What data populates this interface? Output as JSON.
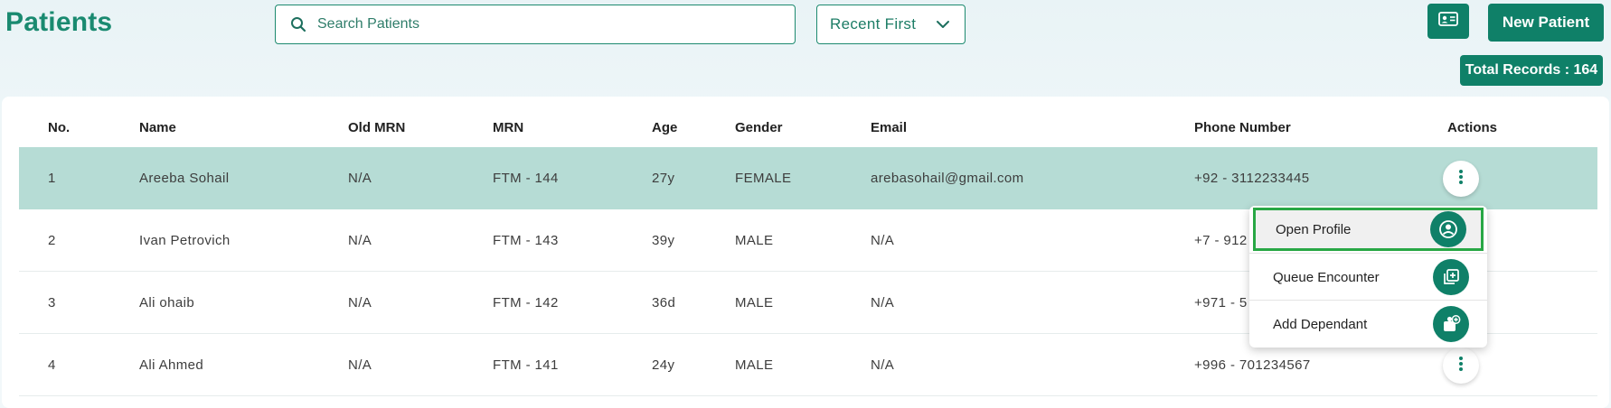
{
  "header": {
    "title": "Patients",
    "search": {
      "placeholder": "Search Patients",
      "value": ""
    },
    "sort": {
      "selected": "Recent First"
    },
    "new_patient_label": "New Patient",
    "total_records_label": "Total Records : 164"
  },
  "table": {
    "columns": [
      "No.",
      "Name",
      "Old MRN",
      "MRN",
      "Age",
      "Gender",
      "Email",
      "Phone Number",
      "Actions"
    ],
    "rows": [
      {
        "no": "1",
        "name": "Areeba Sohail",
        "old_mrn": "N/A",
        "mrn": "FTM - 144",
        "age": "27y",
        "gender": "FEMALE",
        "email": "arebasohail@gmail.com",
        "phone": "+92 - 3112233445"
      },
      {
        "no": "2",
        "name": "Ivan Petrovich",
        "old_mrn": "N/A",
        "mrn": "FTM - 143",
        "age": "39y",
        "gender": "MALE",
        "email": "N/A",
        "phone": "+7 - 912"
      },
      {
        "no": "3",
        "name": "Ali ohaib",
        "old_mrn": "N/A",
        "mrn": "FTM - 142",
        "age": "36d",
        "gender": "MALE",
        "email": "N/A",
        "phone": "+971 - 5"
      },
      {
        "no": "4",
        "name": "Ali Ahmed",
        "old_mrn": "N/A",
        "mrn": "FTM - 141",
        "age": "24y",
        "gender": "MALE",
        "email": "N/A",
        "phone": "+996 - 701234567"
      }
    ],
    "selected_row": 1
  },
  "action_menu": {
    "items": [
      {
        "label": "Open Profile",
        "icon": "user-circle-icon",
        "highlighted": true
      },
      {
        "label": "Queue Encounter",
        "icon": "queue-add-icon",
        "highlighted": false
      },
      {
        "label": "Add Dependant",
        "icon": "add-dependant-icon",
        "highlighted": false
      }
    ]
  },
  "colors": {
    "brand": "#0f8068",
    "title": "#1a8a70",
    "selected_row": "#b6dcd5",
    "highlight_border": "#28a745"
  }
}
